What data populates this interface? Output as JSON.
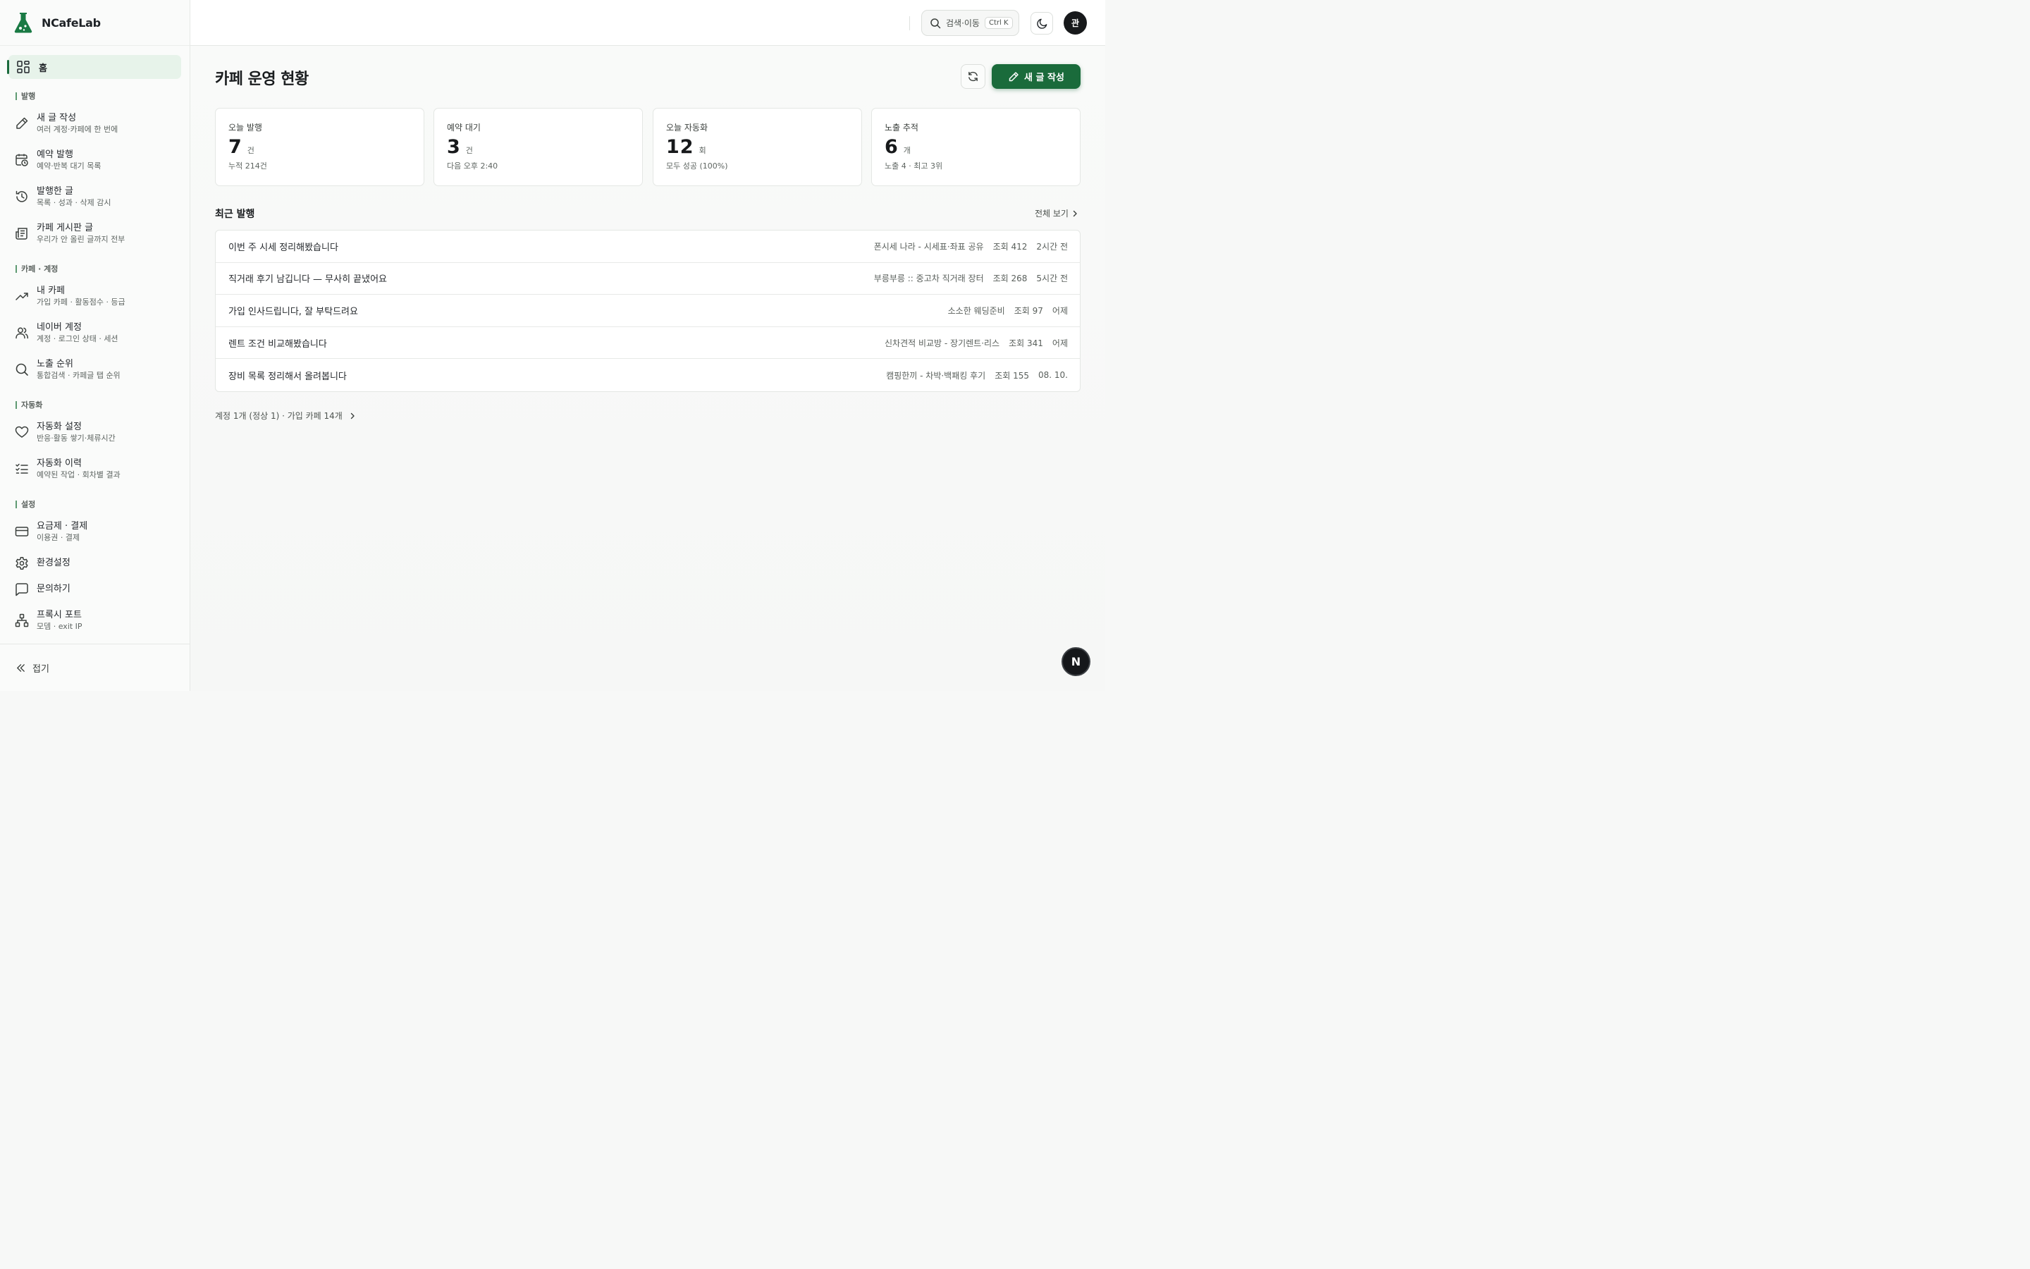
{
  "brand": {
    "name": "NCafeLab"
  },
  "colors": {
    "accent": "#1a6b3b",
    "accent_light": "#e7f3ea",
    "dark": "#15171a"
  },
  "sidebar": {
    "home": {
      "label": "홈",
      "icon": "dashboard-icon"
    },
    "sections": {
      "publish": "발행",
      "cafe_account": "카페 · 계정",
      "automation": "자동화",
      "settings": "설정"
    },
    "items": {
      "new_post": {
        "title": "새 글 작성",
        "desc": "여러 계정·카페에 한 번에"
      },
      "scheduled": {
        "title": "예약 발행",
        "desc": "예약·반복 대기 목록"
      },
      "published": {
        "title": "발행한 글",
        "desc": "목록 · 성과 · 삭제 감시"
      },
      "board": {
        "title": "카페 게시판 글",
        "desc": "우리가 안 올린 글까지 전부"
      },
      "my_cafe": {
        "title": "내 카페",
        "desc": "가입 카페 · 활동점수 · 등급"
      },
      "naver_account": {
        "title": "네이버 계정",
        "desc": "계정 · 로그인 상태 · 세션"
      },
      "ranking": {
        "title": "노출 순위",
        "desc": "통합검색 · 카페글 탭 순위"
      },
      "auto_settings": {
        "title": "자동화 설정",
        "desc": "반응·활동 쌓기·체류시간"
      },
      "auto_history": {
        "title": "자동화 이력",
        "desc": "예약된 작업 · 회차별 결과"
      },
      "billing": {
        "title": "요금제 · 결제",
        "desc": "이용권 · 결제"
      },
      "preferences": {
        "title": "환경설정"
      },
      "contact": {
        "title": "문의하기"
      },
      "proxy": {
        "title": "프록시 포트",
        "desc": "모뎀 · exit IP"
      }
    },
    "collapse_label": "접기"
  },
  "header": {
    "search_placeholder": "검색·이동",
    "search_shortcut": "Ctrl K",
    "avatar_initial": "관"
  },
  "main": {
    "title": "카페 운영 현황",
    "new_post_button": "새 글 작성",
    "stats": [
      {
        "label": "오늘 발행",
        "value": "7",
        "unit": "건",
        "sub": "누적 214건"
      },
      {
        "label": "예약 대기",
        "value": "3",
        "unit": "건",
        "sub": "다음 오후 2:40"
      },
      {
        "label": "오늘 자동화",
        "value": "12",
        "unit": "회",
        "sub": "모두 성공 (100%)"
      },
      {
        "label": "노출 추적",
        "value": "6",
        "unit": "개",
        "sub": "노출 4 · 최고 3위"
      }
    ],
    "recent_title": "최근 발행",
    "see_all": "전체 보기",
    "recent": [
      {
        "title": "이번 주 시세 정리해봤습니다",
        "cafe": "폰시세 나라 - 시세표·좌표 공유",
        "views": "조회 412",
        "time": "2시간 전"
      },
      {
        "title": "직거래 후기 남깁니다 — 무사히 끝냈어요",
        "cafe": "부릉부릉 :: 중고차 직거래 장터",
        "views": "조회 268",
        "time": "5시간 전"
      },
      {
        "title": "가입 인사드립니다, 잘 부탁드려요",
        "cafe": "소소한 웨딩준비",
        "views": "조회 97",
        "time": "어제"
      },
      {
        "title": "렌트 조건 비교해봤습니다",
        "cafe": "신차견적 비교방 - 장기렌트·리스",
        "views": "조회 341",
        "time": "어제"
      },
      {
        "title": "장비 목록 정리해서 올려봅니다",
        "cafe": "캠핑한끼 - 차박·백패킹 후기",
        "views": "조회 155",
        "time": "08. 10."
      }
    ],
    "footer_summary": "계정 1개 (정상 1) · 가입 카페 14개"
  },
  "fab_label": "N"
}
